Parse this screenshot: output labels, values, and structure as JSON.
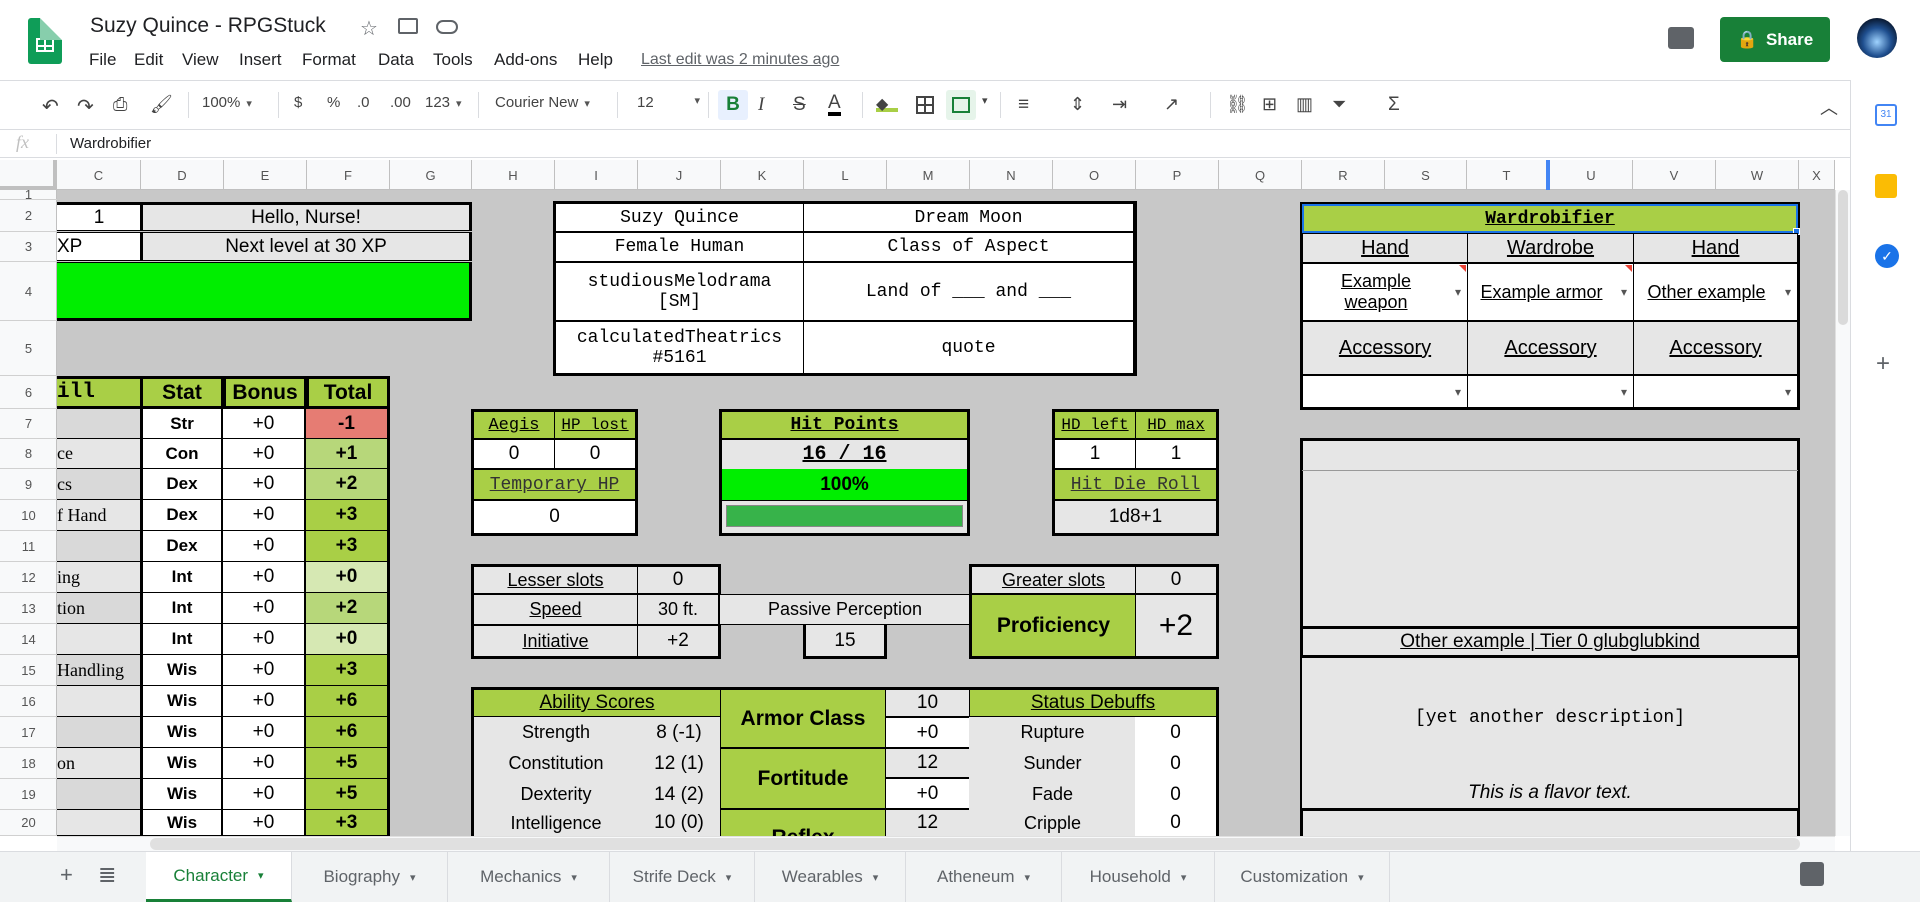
{
  "doc": {
    "title": "Suzy Quince - RPGStuck",
    "last_edit": "Last edit was 2 minutes ago",
    "share": "Share"
  },
  "menu": [
    "File",
    "Edit",
    "View",
    "Insert",
    "Format",
    "Data",
    "Tools",
    "Add-ons",
    "Help"
  ],
  "toolbar": {
    "zoom": "100%",
    "currency": "$",
    "percent": "%",
    "dec_dec": ".0",
    "inc_dec": ".00",
    "more_formats": "123",
    "font": "Courier New",
    "size": "12",
    "bold": "B"
  },
  "formula": {
    "fx": "fx",
    "value": "Wardrobifier"
  },
  "columns": [
    "C",
    "D",
    "E",
    "F",
    "G",
    "H",
    "I",
    "J",
    "K",
    "L",
    "M",
    "N",
    "O",
    "P",
    "Q",
    "R",
    "S",
    "T",
    "U",
    "V",
    "W",
    "X"
  ],
  "rows": [
    "1",
    "2",
    "3",
    "4",
    "5",
    "6",
    "7",
    "8",
    "9",
    "10",
    "11",
    "12",
    "13",
    "14",
    "15",
    "16",
    "17",
    "18",
    "19",
    "20"
  ],
  "sheet": {
    "level": "1",
    "hello": "Hello, Nurse!",
    "xp": "XP",
    "nextlevel": "Next level at 30 XP",
    "id": {
      "name": "Suzy Quince",
      "moon": "Dream Moon",
      "species": "Female Human",
      "class": "Class of Aspect",
      "chumhandle": "studiousMelodrama [SM]",
      "land": "Land of ___ and ___",
      "handle2": "calculatedTheatrics #5161",
      "quote": "quote"
    },
    "skills_header": {
      "skill": "ill",
      "stat": "Stat",
      "bonus": "Bonus",
      "total": "Total"
    },
    "skills": [
      {
        "name": "",
        "stat": "Str",
        "bonus": "+0",
        "total": "-1",
        "color": "#e67c73"
      },
      {
        "name": "ce",
        "stat": "Con",
        "bonus": "+0",
        "total": "+1",
        "color": "#b7d77a"
      },
      {
        "name": "cs",
        "stat": "Dex",
        "bonus": "+0",
        "total": "+2",
        "color": "#b7d77a"
      },
      {
        "name": "f Hand",
        "stat": "Dex",
        "bonus": "+0",
        "total": "+3",
        "color": "#a9cf46"
      },
      {
        "name": "",
        "stat": "Dex",
        "bonus": "+0",
        "total": "+3",
        "color": "#a9cf46"
      },
      {
        "name": "ing",
        "stat": "Int",
        "bonus": "+0",
        "total": "+0",
        "color": "#d6e8b3"
      },
      {
        "name": "tion",
        "stat": "Int",
        "bonus": "+0",
        "total": "+2",
        "color": "#b7d77a"
      },
      {
        "name": "",
        "stat": "Int",
        "bonus": "+0",
        "total": "+0",
        "color": "#d6e8b3"
      },
      {
        "name": "Handling",
        "stat": "Wis",
        "bonus": "+0",
        "total": "+3",
        "color": "#a9cf46"
      },
      {
        "name": "",
        "stat": "Wis",
        "bonus": "+0",
        "total": "+6",
        "color": "#a9cf46"
      },
      {
        "name": "",
        "stat": "Wis",
        "bonus": "+0",
        "total": "+6",
        "color": "#a9cf46"
      },
      {
        "name": "on",
        "stat": "Wis",
        "bonus": "+0",
        "total": "+5",
        "color": "#a9cf46"
      },
      {
        "name": "",
        "stat": "Wis",
        "bonus": "+0",
        "total": "+5",
        "color": "#a9cf46"
      },
      {
        "name": "",
        "stat": "Wis",
        "bonus": "+0",
        "total": "+3",
        "color": "#a9cf46"
      }
    ],
    "aegis": {
      "label": "Aegis",
      "value": "0"
    },
    "hplost": {
      "label": "HP lost",
      "value": "0"
    },
    "temphp": {
      "label": "Temporary HP",
      "value": "0"
    },
    "hp": {
      "label": "Hit Points",
      "value": "16 / 16",
      "pct": "100%",
      "fill": 1.0
    },
    "hd": {
      "left_label": "HD left",
      "left": "1",
      "max_label": "HD max",
      "max": "1",
      "roll_label": "Hit Die Roll",
      "roll": "1d8+1"
    },
    "slots": {
      "lesser_label": "Lesser slots",
      "lesser": "0",
      "greater_label": "Greater slots",
      "greater": "0"
    },
    "speed": {
      "label": "Speed",
      "value": "30 ft."
    },
    "initiative": {
      "label": "Initiative",
      "value": "+2"
    },
    "passive": {
      "label": "Passive Perception",
      "value": "15"
    },
    "proficiency": {
      "label": "Proficiency",
      "value": "+2"
    },
    "abilities": {
      "label": "Ability Scores",
      "items": [
        {
          "name": "Strength",
          "value": "8 (-1)"
        },
        {
          "name": "Constitution",
          "value": "12 (1)"
        },
        {
          "name": "Dexterity",
          "value": "14 (2)"
        },
        {
          "name": "Intelligence",
          "value": "10 (0)"
        }
      ]
    },
    "armor": {
      "label": "Armor Class",
      "value": "10",
      "bonus": "+0"
    },
    "fortitude": {
      "label": "Fortitude",
      "value": "12",
      "bonus": "+0"
    },
    "reflex": {
      "label": "Reflex",
      "value": "12"
    },
    "debuffs": {
      "label": "Status Debuffs",
      "items": [
        {
          "name": "Rupture",
          "value": "0"
        },
        {
          "name": "Sunder",
          "value": "0"
        },
        {
          "name": "Fade",
          "value": "0"
        },
        {
          "name": "Cripple",
          "value": "0"
        }
      ]
    },
    "wardrobe": {
      "title": "Wardrobifier",
      "hand1": "Hand",
      "wardrobe": "Wardrobe",
      "hand2": "Hand",
      "weapon": "Example weapon",
      "armor": "Example armor",
      "other": "Other example",
      "acc1": "Accessory",
      "acc2": "Accessory",
      "acc3": "Accessory"
    },
    "desc": {
      "item_title": "Other example | Tier 0 glubglubkind",
      "description": "[yet another description]",
      "flavor": "This is a flavor text."
    }
  },
  "tabs": [
    "Character",
    "Biography",
    "Mechanics",
    "Strife Deck",
    "Wearables",
    "Atheneum",
    "Household",
    "Customization"
  ]
}
